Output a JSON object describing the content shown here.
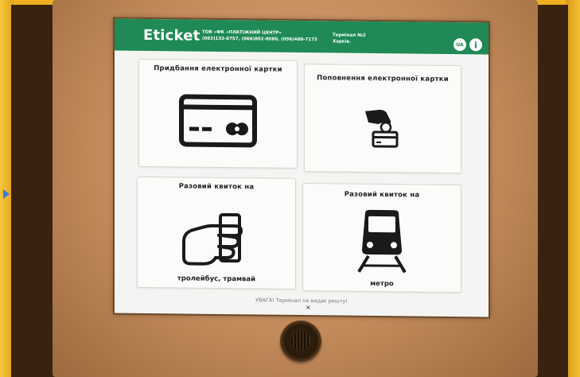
{
  "header": {
    "logo": "Eticket",
    "company_line1": "ТОВ «ФК «ПЛАТІЖНИЙ ЦЕНТР»",
    "company_line2": "(063)133-6757, (066)802-8080, (096)488-7173",
    "terminal_line1": "Термінал №2",
    "terminal_line2": "Харків.",
    "lang_button": "UA",
    "info_button": "i"
  },
  "tiles": [
    {
      "title": "Придбання електронної картки",
      "subtitle": "",
      "icon": "credit-card-icon"
    },
    {
      "title": "Поповнення електронної картки",
      "subtitle": "",
      "icon": "hand-coin-card-icon"
    },
    {
      "title": "Разовий квиток на",
      "subtitle": "тролейбус, трамвай",
      "icon": "hand-ticket-icon"
    },
    {
      "title": "Разовий квиток на",
      "subtitle": "метро",
      "icon": "metro-train-icon"
    }
  ],
  "footer": {
    "warning": "УВАГА! Термінал не видає решту!",
    "close": "×"
  },
  "colors": {
    "header_green": "#1f8a55",
    "screen_bg": "#f4f5f3",
    "bezel": "#c48c5c"
  }
}
